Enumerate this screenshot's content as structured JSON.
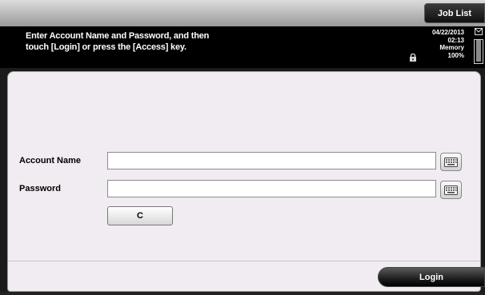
{
  "header": {
    "job_list_label": "Job List"
  },
  "message": {
    "text": "Enter Account Name and Password, and then\ntouch [Login] or press the [Access] key."
  },
  "status": {
    "date": "04/22/2013",
    "time": "02:13",
    "memory_label": "Memory",
    "memory_value": "100%",
    "memory_level": 1.0
  },
  "form": {
    "account_name_label": "Account Name",
    "account_name_value": "",
    "password_label": "Password",
    "password_value": "",
    "clear_label": "C"
  },
  "footer": {
    "login_label": "Login"
  },
  "icons": {
    "lock": "lock-icon",
    "keyboard": "keyboard-icon",
    "status": "status-icon"
  }
}
